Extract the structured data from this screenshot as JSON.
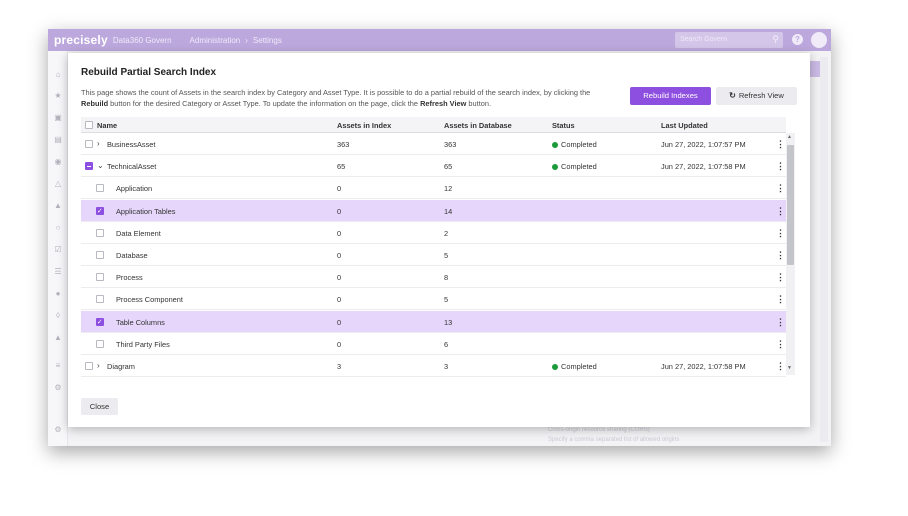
{
  "app": {
    "brand": "precisely",
    "product": "Data360 Govern",
    "breadcrumb": [
      "Administration",
      "Settings"
    ],
    "breadcrumb_sep": "›",
    "search_placeholder": "Search Govern",
    "help_glyph": "?"
  },
  "background_text": {
    "cors_title": "Cross-origin resource sharing (CORS)",
    "cors_desc": "Specify a comma separated list of allowed origins"
  },
  "modal": {
    "title": "Rebuild Partial Search Index",
    "description": {
      "p1": "This page shows the count of Assets in the search index by Category and Asset Type. It is possible to do a partial rebuild of the search index, by clicking the ",
      "b1": "Rebuild",
      "p2": " button for the desired Category or Asset Type. To update the information on the page, click the ",
      "b2": "Refresh View",
      "p3": " button."
    },
    "rebuild_button": "Rebuild Indexes",
    "refresh_button": "Refresh View",
    "close_button": "Close"
  },
  "table": {
    "columns": {
      "name": "Name",
      "in_index": "Assets in Index",
      "in_db": "Assets in Database",
      "status": "Status",
      "updated": "Last Updated"
    },
    "rows": [
      {
        "name": "BusinessAsset",
        "level": 0,
        "expand": "collapsed",
        "check": "unchecked",
        "in_index": "363",
        "in_db": "363",
        "status": "Completed",
        "updated": "Jun 27, 2022, 1:07:57 PM",
        "selected": false
      },
      {
        "name": "TechnicalAsset",
        "level": 0,
        "expand": "expanded",
        "check": "mixed",
        "in_index": "65",
        "in_db": "65",
        "status": "Completed",
        "updated": "Jun 27, 2022, 1:07:58 PM",
        "selected": false
      },
      {
        "name": "Application",
        "level": 1,
        "expand": "none",
        "check": "unchecked",
        "in_index": "0",
        "in_db": "12",
        "status": "",
        "updated": "",
        "selected": false
      },
      {
        "name": "Application Tables",
        "level": 1,
        "expand": "none",
        "check": "checked",
        "in_index": "0",
        "in_db": "14",
        "status": "",
        "updated": "",
        "selected": true
      },
      {
        "name": "Data Element",
        "level": 1,
        "expand": "none",
        "check": "unchecked",
        "in_index": "0",
        "in_db": "2",
        "status": "",
        "updated": "",
        "selected": false
      },
      {
        "name": "Database",
        "level": 1,
        "expand": "none",
        "check": "unchecked",
        "in_index": "0",
        "in_db": "5",
        "status": "",
        "updated": "",
        "selected": false
      },
      {
        "name": "Process",
        "level": 1,
        "expand": "none",
        "check": "unchecked",
        "in_index": "0",
        "in_db": "8",
        "status": "",
        "updated": "",
        "selected": false
      },
      {
        "name": "Process Component",
        "level": 1,
        "expand": "none",
        "check": "unchecked",
        "in_index": "0",
        "in_db": "5",
        "status": "",
        "updated": "",
        "selected": false
      },
      {
        "name": "Table Columns",
        "level": 1,
        "expand": "none",
        "check": "checked",
        "in_index": "0",
        "in_db": "13",
        "status": "",
        "updated": "",
        "selected": true
      },
      {
        "name": "Third Party Files",
        "level": 1,
        "expand": "none",
        "check": "unchecked",
        "in_index": "0",
        "in_db": "6",
        "status": "",
        "updated": "",
        "selected": false
      },
      {
        "name": "Diagram",
        "level": 0,
        "expand": "collapsed",
        "check": "unchecked",
        "in_index": "3",
        "in_db": "3",
        "status": "Completed",
        "updated": "Jun 27, 2022, 1:07:58 PM",
        "selected": false
      }
    ]
  },
  "colors": {
    "accent": "#8d4fe0",
    "selected_row": "#e6d6fb",
    "topbar": "#bca8dd",
    "status_completed": "#1a9b3a"
  }
}
